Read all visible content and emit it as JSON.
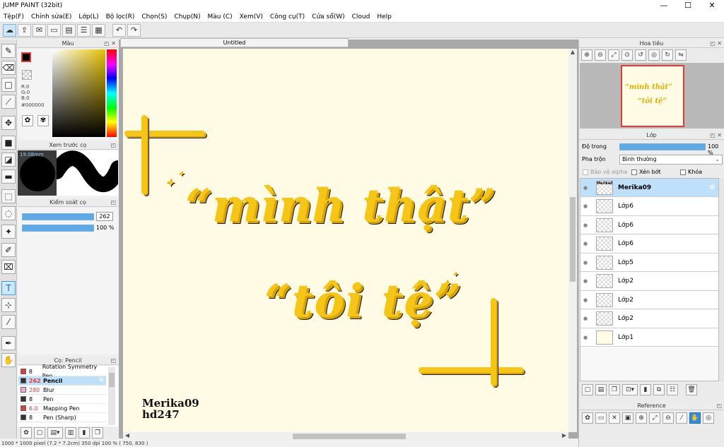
{
  "app": {
    "title": "JUMP PAINT (32bit)"
  },
  "window_controls": {
    "minimize": "—",
    "maximize": "☐",
    "close": "✕"
  },
  "menu": [
    "Tệp(F)",
    "Chỉnh sửa(E)",
    "Lớp(L)",
    "Bộ lọc(R)",
    "Chọn(S)",
    "Chụp(N)",
    "Màu (C)",
    "Xem(V)",
    "Công cụ(T)",
    "Cửa sổ(W)",
    "Cloud",
    "Help"
  ],
  "color_panel": {
    "title": "Màu",
    "r": "R:0",
    "g": "G:0",
    "b": "B:0",
    "hex": "#000000",
    "primary": "#000000"
  },
  "brush_preview": {
    "title": "Xem trước cọ",
    "size": "19.08mm"
  },
  "brush_control": {
    "title": "Kiểm soát cọ",
    "size_value": "262",
    "opacity_value": "100 %",
    "size_fill": 1.0,
    "opacity_fill": 1.0
  },
  "brush_list": {
    "title": "Cọ: Pencil",
    "items": [
      {
        "size": "8",
        "name": "Rotation Symmetry Pen",
        "color": "#e03b3b",
        "size_color": "#000000"
      },
      {
        "size": "262",
        "name": "Pencil",
        "color": "#333333",
        "size_color": "#e03b3b"
      },
      {
        "size": "280",
        "name": "Blur",
        "color": "#f3a6e6",
        "size_color": "#e03b3b"
      },
      {
        "size": "8",
        "name": "Pen",
        "color": "#333333",
        "size_color": "#000000"
      },
      {
        "size": "6.0",
        "name": "Mapping Pen",
        "color": "#e03b3b",
        "size_color": "#e03b3b"
      },
      {
        "size": "8",
        "name": "Pen (Sharp)",
        "color": "#333333",
        "size_color": "#000000"
      }
    ]
  },
  "canvas": {
    "tab": "Untitled",
    "line1": "“mình thật”",
    "line2": "“tôi tệ”",
    "signature1": "Merika09",
    "signature2": "hd247",
    "text_color": "#f5c518"
  },
  "navigator": {
    "title": "Hoa tiêu",
    "preview_line1": "“mình thật”",
    "preview_line2": "“tôi tệ”"
  },
  "layer_panel": {
    "title": "Lớp",
    "opacity_label": "Độ trong",
    "opacity_value": "100 %",
    "opacity_fill": 1.0,
    "blend_label": "Pha trộn",
    "blend_value": "Bình thường",
    "protect_alpha": "Bảo vệ alpha",
    "clipping": "Xén bớt",
    "lock": "Khóa",
    "layers": [
      {
        "name": "Merika09",
        "thumb": "Merika09"
      },
      {
        "name": "Lớp6",
        "thumb": ""
      },
      {
        "name": "Lớp6",
        "thumb": ""
      },
      {
        "name": "Lớp6",
        "thumb": ""
      },
      {
        "name": "Lớp5",
        "thumb": ""
      },
      {
        "name": "Lớp2",
        "thumb": ""
      },
      {
        "name": "Lớp2",
        "thumb": ""
      },
      {
        "name": "Lớp2",
        "thumb": ""
      },
      {
        "name": "Lớp1",
        "thumb": ""
      }
    ]
  },
  "reference": {
    "title": "Reference"
  },
  "status": {
    "text": "1000 * 1000 pixel   (7.2 * 7.2cm)   350 dpi   100 %   ( 750, 830 )"
  }
}
